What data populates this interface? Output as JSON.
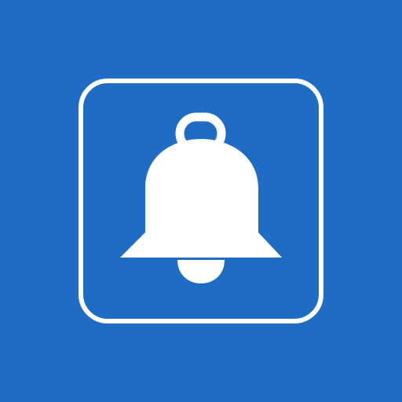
{
  "app": {
    "icon": "bell-icon",
    "frame": "rounded-square-outline-icon"
  },
  "colors": {
    "background": "#1f6cc4",
    "foreground": "#ffffff"
  }
}
